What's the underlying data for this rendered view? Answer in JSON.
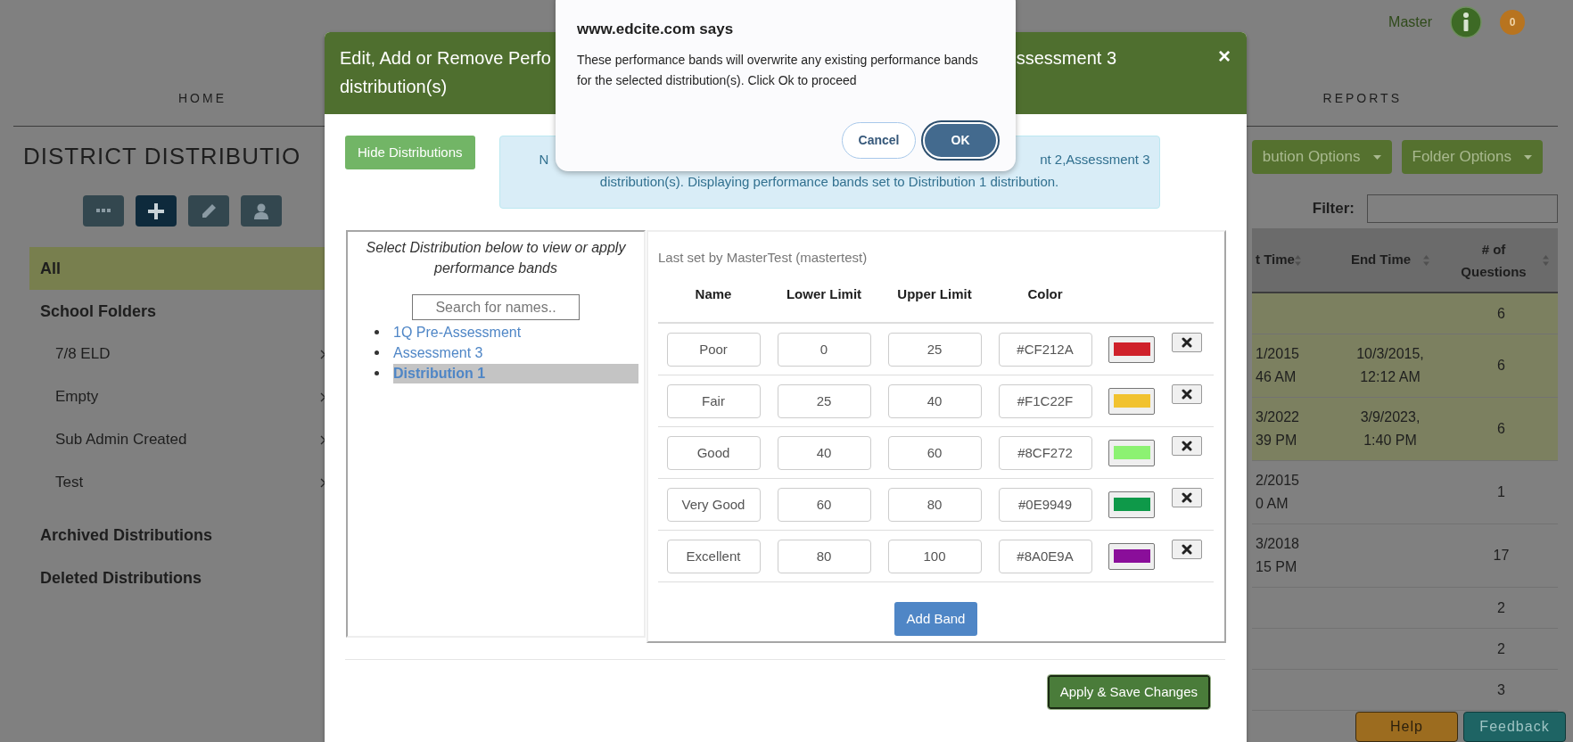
{
  "header": {
    "user": "Master",
    "notification_count": "0"
  },
  "nav": [
    {
      "label": "HOME"
    },
    {
      "label": "REPORTS"
    }
  ],
  "page_title": "DISTRICT DISTRIBUTIO",
  "sidebar": {
    "items": [
      {
        "label": "All",
        "selected": true
      },
      {
        "label": "School Folders",
        "selected": false,
        "children": [
          {
            "label": "7/8 ELD",
            "selected": false
          },
          {
            "label": "Empty",
            "selected": false
          },
          {
            "label": "Sub Admin Created",
            "selected": false
          },
          {
            "label": "Test",
            "selected": false
          }
        ]
      },
      {
        "label": "Archived Distributions",
        "selected": false
      },
      {
        "label": "Deleted Distributions",
        "selected": false
      }
    ]
  },
  "actions": [
    {
      "label": "bution Options"
    },
    {
      "label": "Folder Options"
    }
  ],
  "filter": {
    "label": "Filter:"
  },
  "table": {
    "columns": [
      "t Time",
      "End Time",
      "# of Questions"
    ],
    "rows": [
      {
        "highlighted": true,
        "questions": "6"
      },
      {
        "highlighted": true,
        "column_1": "1/2015 46 AM",
        "end_time": "10/3/2015, 12:12 AM",
        "questions": "6"
      },
      {
        "highlighted": true,
        "column_1": "3/2022 39 PM",
        "end_time": "3/9/2023, 1:40 PM",
        "questions": "6"
      },
      {
        "highlighted": false,
        "column_1": "2/2015 0 AM",
        "questions": "1"
      },
      {
        "highlighted": false,
        "column_1": "3/2018 15 PM",
        "questions": "17"
      },
      {
        "highlighted": false,
        "questions": "2"
      },
      {
        "highlighted": false,
        "questions": "2"
      },
      {
        "highlighted": false,
        "questions": "3"
      }
    ]
  },
  "corner_buttons": [
    {
      "label": "Help",
      "kind": "help"
    },
    {
      "label": "Feedback",
      "kind": "feedback"
    }
  ],
  "modal": {
    "title_start": "Edit, Add or Remove Perfo",
    "title_end": "ssessment 3",
    "title_line2": "distribution(s)",
    "close": "×",
    "toggle_button": "Hide Distributions",
    "notice": {
      "line1_start": "N",
      "line1_end": "nt 2,Assessment 3",
      "line2": "distribution(s). Displaying performance bands set to Distribution 1 distribution."
    },
    "distributions": {
      "heading": "Select Distribution below to view or apply performance bands",
      "search_placeholder": "Search for names..",
      "items": [
        {
          "label": "1Q Pre-Assessment",
          "selected": false
        },
        {
          "label": "Assessment 3",
          "selected": false
        },
        {
          "label": "Distribution 1",
          "selected": true
        }
      ]
    },
    "bands": {
      "last_set": "Last set by MasterTest (mastertest)",
      "columns": [
        "Name",
        "Lower Limit",
        "Upper Limit",
        "Color"
      ],
      "rows": [
        {
          "name": "Poor",
          "lower": "0",
          "upper": "25",
          "hex": "#CF212A",
          "color": "#cf212a"
        },
        {
          "name": "Fair",
          "lower": "25",
          "upper": "40",
          "hex": "#F1C22F",
          "color": "#f1c22f"
        },
        {
          "name": "Good",
          "lower": "40",
          "upper": "60",
          "hex": "#8CF272",
          "color": "#8cf272"
        },
        {
          "name": "Very Good",
          "lower": "60",
          "upper": "80",
          "hex": "#0E9949",
          "color": "#0e9949"
        },
        {
          "name": "Excellent",
          "lower": "80",
          "upper": "100",
          "hex": "#8A0E9A",
          "color": "#8a0e9a"
        }
      ],
      "add_button": "Add Band"
    },
    "save_button": "Apply & Save Changes"
  },
  "alert": {
    "title": "www.edcite.com says",
    "message": "These performance bands will overwrite any existing performance bands for the selected distribution(s). Click Ok to proceed",
    "buttons": [
      {
        "label": "Cancel",
        "selected": false
      },
      {
        "label": "OK",
        "selected": true
      }
    ]
  }
}
